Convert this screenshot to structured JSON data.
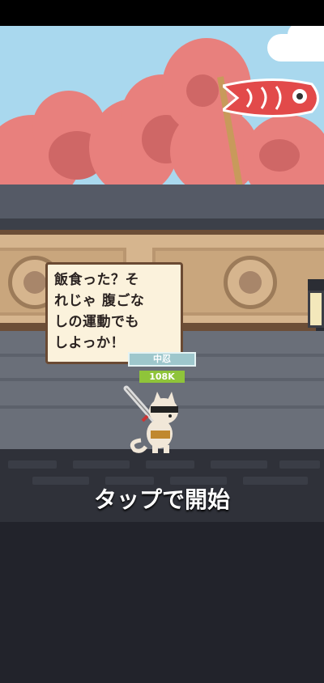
{
  "speech_bubble": {
    "text": "飯食った？そ\nれじゃ 腹ごな\nしの運動でも\nしよっか！"
  },
  "player": {
    "rank_label": "中忍",
    "power_label": "108K"
  },
  "prompt": {
    "tap_to_start": "タップで開始"
  },
  "colors": {
    "sky": "#a9d8ee",
    "blossom": "#e8807d",
    "wall": "#d6b58e",
    "street": "#6a6f79",
    "bottom": "#22232b",
    "power_badge": "#8fc43a",
    "rank_badge": "#9ec7cc"
  }
}
